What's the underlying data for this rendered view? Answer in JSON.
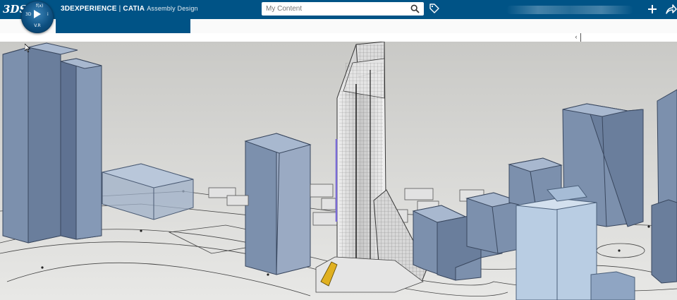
{
  "app": {
    "logo": "3DS",
    "brand": "3DEXPERIENCE",
    "separator": " | ",
    "product": "CATIA",
    "app_name": "Assembly Design"
  },
  "compass": {
    "label_3d": "3D",
    "label_top": "f(x)",
    "label_right": "i",
    "version": "V.R"
  },
  "search": {
    "placeholder": "My Content"
  },
  "toolbar": {
    "collapse_glyph": "‹"
  },
  "icons": {
    "search": "search-icon",
    "tag": "tag-icon",
    "plus": "plus-icon",
    "share": "share-icon",
    "compass": "compass-icon",
    "cursor": "mouse-cursor-icon"
  },
  "colors": {
    "topbar": "#005386",
    "building": "#7c90ad",
    "building_dark": "#5f7292",
    "building_light": "#a8b8cf",
    "glass": "#b9cde3"
  }
}
